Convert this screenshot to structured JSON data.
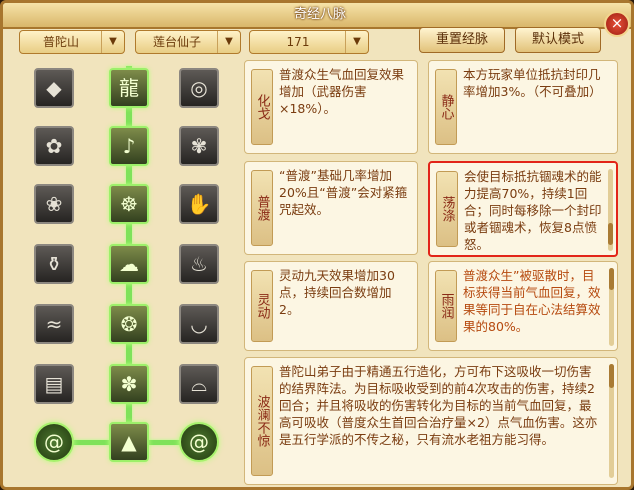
{
  "window": {
    "title": "奇经八脉",
    "close_label": "×"
  },
  "toolbar": {
    "school": "普陀山",
    "faction": "莲台仙子",
    "level": "171",
    "reset_label": "重置经脉",
    "default_label": "默认模式"
  },
  "tree_icons": {
    "row1": [
      "gem-ball-icon",
      "dragon-icon",
      "orb-ring-icon"
    ],
    "row2": [
      "lotus-icon",
      "bell-icon",
      "paw-icon"
    ],
    "row3": [
      "lotus-blade-icon",
      "buddha-icon",
      "hand-icon"
    ],
    "row4": [
      "vase-icon",
      "cloud-icon",
      "pot-icon"
    ],
    "row5": [
      "wave-icon",
      "vortex-icon",
      "bowl-icon"
    ],
    "row6": [
      "scroll-icon",
      "flower-icon",
      "lotus-seat-icon"
    ],
    "row7": [
      "spiral-icon",
      "mountain-icon",
      "spiral-icon"
    ]
  },
  "cards": {
    "huage": {
      "label": "化戈",
      "text": "普渡众生气血回复效果增加（武器伤害×18%）。"
    },
    "jingxin": {
      "label": "静心",
      "text": "本方玩家单位抵抗封印几率增加3%。（不可叠加）"
    },
    "pudu": {
      "label": "普渡",
      "text": "“普渡”基础几率增加20%且“普渡”会对紧箍咒起效。"
    },
    "dangdi": {
      "label": "荡涤",
      "text": "会使目标抵抗锢魂术的能力提高70%，持续1回合；同时每移除一个封印或者锢魂术，恢复8点愤怒。"
    },
    "lingdong": {
      "label": "灵动",
      "text": "灵动九天效果增加30点，持续回合数增加2。"
    },
    "yurun": {
      "label": "雨润",
      "text": "普渡众生”被驱散时，目标获得当前气血回复，效果等同于自在心法结算效果的80%。"
    },
    "bolan": {
      "label": "波澜不惊",
      "text": "普陀山弟子由于精通五行造化，方可布下这吸收一切伤害的结界阵法。为目标吸收受到的前4次攻击的伤害，持续2回合；并且将吸收的伤害转化为目标的当前气血回复，最高可吸收（普度众生首回合治疗量×2）点气血伤害。这亦是五行学派的不传之秘，只有流水老祖方能习得。"
    }
  },
  "colors": {
    "accent": "#9df06a",
    "selected_border": "#e22418",
    "frame": "#a8762e"
  }
}
